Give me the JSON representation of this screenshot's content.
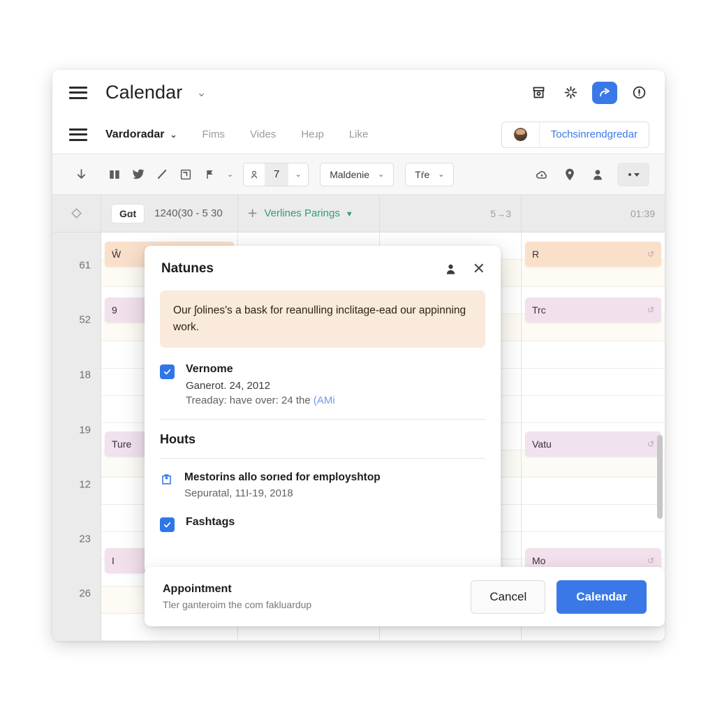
{
  "window": {
    "titlebar": {
      "menu_icon": "hamburger-icon",
      "title": "Calendar",
      "title_caret": "⌄",
      "actions": [
        {
          "name": "archive-icon",
          "glyph": "archive"
        },
        {
          "name": "sparkle-icon",
          "glyph": "sparkle"
        },
        {
          "name": "share-icon",
          "glyph": "share",
          "accent": true
        },
        {
          "name": "info-icon",
          "glyph": "info"
        }
      ]
    },
    "navbar": {
      "menu_icon": "hamburger-icon",
      "brand": "Vardoradar",
      "brand_caret": "⌄",
      "links": [
        "Fims",
        "Vides",
        "Heɹp",
        "Like"
      ],
      "account": {
        "name": "Tochsinrendgredar",
        "avatar": "user-avatar"
      }
    },
    "toolbar": {
      "icons": [
        "download-icon",
        "book-icon",
        "twitter-bird-icon",
        "pencil-icon",
        "frame-icon",
        "flag-icon"
      ],
      "dropdown_caret": "⌄",
      "stepper": {
        "person_icon": "person-icon",
        "value": "7",
        "caret": "⌄"
      },
      "selects": [
        {
          "label": "Maldenie",
          "caret": "⌄"
        },
        {
          "label": "Tŕe",
          "caret": "⌄"
        }
      ],
      "right_icons": [
        "cloud-icon",
        "location-pin-icon",
        "person-icon"
      ],
      "more_label": "more-options"
    }
  },
  "calendar": {
    "header": {
      "gutter_icon": "diamond-icon",
      "today_button": "Gɑt",
      "date_range": "1240(30 - 5 30",
      "add_icon": "+",
      "group_label": "Verlines Parings",
      "group_caret": "▼",
      "meta_1": "5→3",
      "meta_2": "01:39"
    },
    "gutter_labels": [
      "61",
      "52",
      "18",
      "19",
      "12",
      "23",
      "26"
    ],
    "events_col1": [
      {
        "label": "Ŵ",
        "color": "peach",
        "badge": ""
      },
      {
        "label": "9",
        "color": "pink",
        "badge": ""
      },
      {
        "label": "Ture",
        "color": "lilac",
        "badge": ""
      },
      {
        "label": "I",
        "color": "pink",
        "badge": ""
      }
    ],
    "events_col4": [
      {
        "label": "R",
        "color": "peach",
        "badge": "↺"
      },
      {
        "label": "Trc",
        "color": "pink",
        "badge": "↺"
      },
      {
        "label": "Vatu",
        "color": "lilac",
        "badge": "↺"
      },
      {
        "label": "Mo",
        "color": "pink",
        "badge": "↺"
      }
    ]
  },
  "modal": {
    "title": "Natunes",
    "person_icon": "person-icon",
    "close_icon": "✕",
    "notice": "Our ʃolines's a bask for reanulling inclitage-ead our appinning work.",
    "checkbox_item": {
      "checked": true,
      "title": "Vernome",
      "subtitle": "Ganerot. 24, 2012",
      "detail_prefix": "Treaday: have over: 24 the ",
      "detail_link": "(AMi"
    },
    "section_title": "Houts",
    "list_item": {
      "icon": "clipboard-icon",
      "title": "Mestorins allo sorıed for employshtop",
      "subtitle": "Sepuratal, 11I-19, 2018"
    },
    "bottom_checkbox": {
      "checked": true,
      "title": "Fashtags"
    }
  },
  "footer": {
    "title": "Appointment",
    "subtitle": "Tler ganteroim the com fakluardup",
    "cancel_label": "Cancel",
    "primary_label": "Calendar"
  },
  "colors": {
    "accent": "#3b78e7",
    "checkbox": "#2f76e8",
    "green": "#2f9e6e",
    "notice_bg": "#faeadb",
    "toolbar_bg": "#f7f7f7",
    "header_bg": "#ebebeb"
  }
}
